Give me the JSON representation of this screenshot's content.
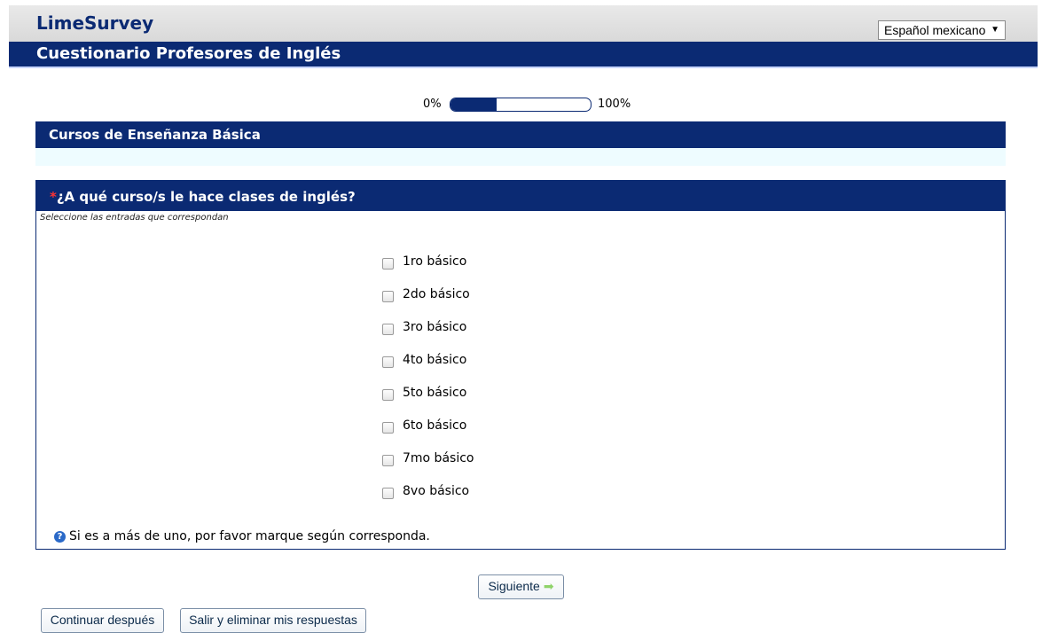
{
  "header": {
    "brand": "LimeSurvey",
    "language": "Español mexicano",
    "language_arrow": "▼",
    "survey_title": "Cuestionario Profesores de Inglés"
  },
  "progress": {
    "start_label": "0%",
    "end_label": "100%",
    "value": 0.33
  },
  "group": {
    "title": "Cursos de Enseñanza Básica"
  },
  "question": {
    "required_mark": "*",
    "text": "¿A qué curso/s le hace clases de inglés?",
    "help": "Seleccione las entradas que correspondan",
    "options": [
      {
        "label": "1ro básico",
        "checked": false
      },
      {
        "label": "2do básico",
        "checked": false
      },
      {
        "label": "3ro básico",
        "checked": false
      },
      {
        "label": "4to básico",
        "checked": false
      },
      {
        "label": "5to básico",
        "checked": false
      },
      {
        "label": "6to básico",
        "checked": false
      },
      {
        "label": "7mo básico",
        "checked": false
      },
      {
        "label": "8vo básico",
        "checked": false
      }
    ],
    "tip": "Si es a más de uno, por favor marque según corresponda."
  },
  "buttons": {
    "next": "Siguiente",
    "continue_later": "Continuar después",
    "quit": "Salir y eliminar mis respuestas"
  },
  "colors": {
    "primary": "#0b2a73",
    "accent_required": "#ff3333",
    "next_arrow": "#8fd36a"
  }
}
